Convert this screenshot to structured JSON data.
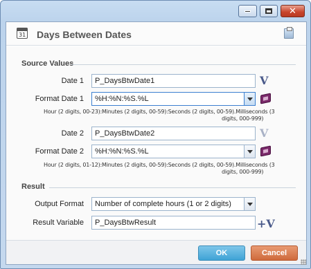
{
  "window": {
    "controls": {
      "minimize": "minimize",
      "maximize": "maximize",
      "close": "✕"
    }
  },
  "dialog": {
    "title": "Days Between Dates",
    "calendar_icon_text": "31"
  },
  "source_values": {
    "title": "Source Values",
    "date1": {
      "label": "Date 1",
      "value": "P_DaysBtwDate1"
    },
    "format1": {
      "label": "Format Date 1",
      "value": "%H:%N:%S.%L",
      "hint_line1": "Hour (2 digits, 00-23):Minutes (2 digits, 00-59):Seconds (2 digits, 00-59).Milliseconds (3",
      "hint_line2": "digits, 000-999)"
    },
    "date2": {
      "label": "Date 2",
      "value": "P_DaysBtwDate2"
    },
    "format2": {
      "label": "Format Date 2",
      "value": "%H:%N:%S.%L",
      "hint_line1": "Hour (2 digits, 01-12):Minutes (2 digits, 00-59):Seconds (2 digits, 00-59).Milliseconds (3",
      "hint_line2": "digits, 000-999)"
    }
  },
  "result": {
    "title": "Result",
    "output_format": {
      "label": "Output Format",
      "value": "Number of complete hours  (1 or 2 digits)"
    },
    "result_variable": {
      "label": "Result Variable",
      "value": "P_DaysBtwResult"
    }
  },
  "icons": {
    "variable": "V",
    "add_variable": "+V"
  },
  "footer": {
    "ok_label": "OK",
    "cancel_label": "Cancel"
  }
}
